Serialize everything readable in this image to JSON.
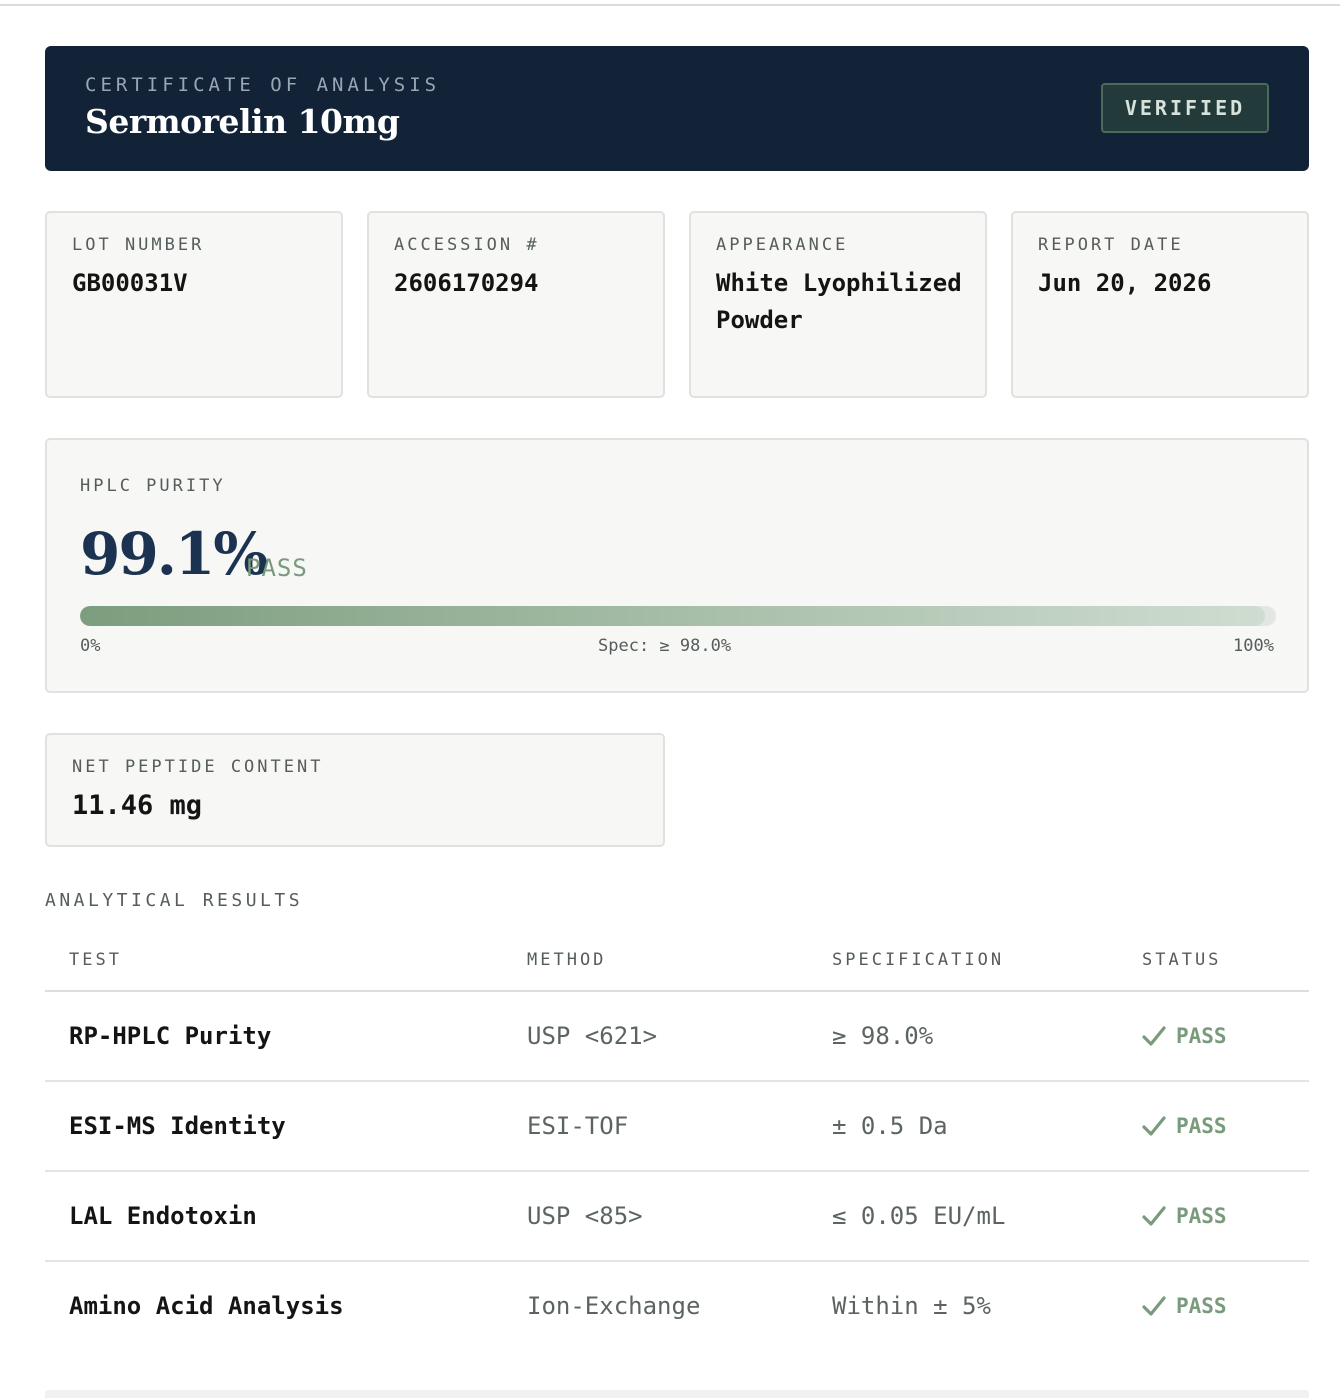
{
  "header": {
    "eyebrow": "CERTIFICATE OF ANALYSIS",
    "product": "Sermorelin 10mg",
    "badge": "VERIFIED"
  },
  "info_cards": [
    {
      "label": "LOT NUMBER",
      "value": "GB00031V"
    },
    {
      "label": "ACCESSION #",
      "value": "2606170294"
    },
    {
      "label": "APPEARANCE",
      "value": "White Lyophilized Powder"
    },
    {
      "label": "REPORT DATE",
      "value": "Jun 20, 2026"
    }
  ],
  "purity": {
    "label": "HPLC PURITY",
    "value": "99.1%",
    "status": "PASS",
    "fill_percent": 99.1,
    "scale_min": "0%",
    "spec": "Spec: ≥ 98.0%",
    "scale_max": "100%"
  },
  "net_peptide": {
    "label": "NET PEPTIDE CONTENT",
    "value": "11.46 mg"
  },
  "results": {
    "title": "ANALYTICAL RESULTS",
    "columns": [
      "TEST",
      "METHOD",
      "SPECIFICATION",
      "STATUS"
    ],
    "rows": [
      {
        "test": "RP-HPLC Purity",
        "method": "USP <621>",
        "spec": "≥ 98.0%",
        "status": "PASS"
      },
      {
        "test": "ESI-MS Identity",
        "method": "ESI-TOF",
        "spec": "± 0.5 Da",
        "status": "PASS"
      },
      {
        "test": "LAL Endotoxin",
        "method": "USP <85>",
        "spec": "≤ 0.05 EU/mL",
        "status": "PASS"
      },
      {
        "test": "Amino Acid Analysis",
        "method": "Ion-Exchange",
        "spec": "Within ± 5%",
        "status": "PASS"
      }
    ]
  },
  "colors": {
    "header_bg": "#122338",
    "pass_green": "#7a9a7c",
    "purity_navy": "#1b3251"
  },
  "icons": {
    "status_icon": "check-icon"
  }
}
